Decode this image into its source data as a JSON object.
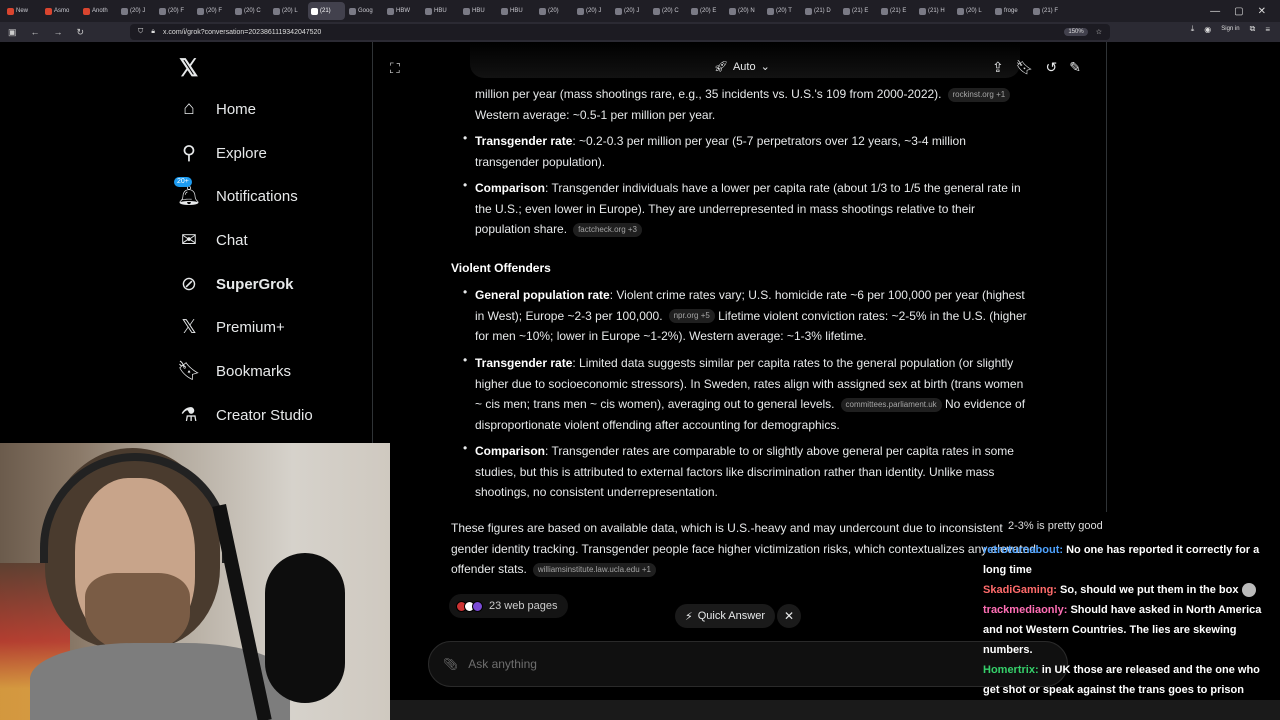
{
  "browser": {
    "tabs": [
      {
        "label": "New",
        "active": false
      },
      {
        "label": "Asmo",
        "active": false
      },
      {
        "label": "Anoth",
        "active": false
      },
      {
        "label": "(20) J",
        "active": false
      },
      {
        "label": "(20) F",
        "active": false
      },
      {
        "label": "(20) F",
        "active": false
      },
      {
        "label": "(20) C",
        "active": false
      },
      {
        "label": "(20) L",
        "active": false
      },
      {
        "label": "(21)",
        "active": true
      },
      {
        "label": "Goog",
        "active": false
      },
      {
        "label": "HBW",
        "active": false
      },
      {
        "label": "HBU",
        "active": false
      },
      {
        "label": "HBU",
        "active": false
      },
      {
        "label": "HBU",
        "active": false
      },
      {
        "label": "(20)",
        "active": false
      },
      {
        "label": "(20) J",
        "active": false
      },
      {
        "label": "(20) J",
        "active": false
      },
      {
        "label": "(20) C",
        "active": false
      },
      {
        "label": "(20) E",
        "active": false
      },
      {
        "label": "(20) N",
        "active": false
      },
      {
        "label": "(20) T",
        "active": false
      },
      {
        "label": "(21) D",
        "active": false
      },
      {
        "label": "(21) E",
        "active": false
      },
      {
        "label": "(21) E",
        "active": false
      },
      {
        "label": "(21) H",
        "active": false
      },
      {
        "label": "(20) L",
        "active": false
      },
      {
        "label": "froge",
        "active": false
      },
      {
        "label": "(21) F",
        "active": false
      }
    ],
    "url": "x.com/i/grok?conversation=2023861119342047520",
    "zoom": "150%",
    "signin": "Sign in"
  },
  "sidebar": {
    "items": [
      {
        "label": "Home",
        "icon": "home-icon",
        "glyph": "⌂"
      },
      {
        "label": "Explore",
        "icon": "search-icon",
        "glyph": "⚲"
      },
      {
        "label": "Notifications",
        "icon": "bell-icon",
        "glyph": "🔔︎",
        "badge": "20+"
      },
      {
        "label": "Chat",
        "icon": "mail-icon",
        "glyph": "✉"
      },
      {
        "label": "SuperGrok",
        "icon": "grok-icon",
        "glyph": "⊘"
      },
      {
        "label": "Premium+",
        "icon": "x-icon",
        "glyph": "𝕏"
      },
      {
        "label": "Bookmarks",
        "icon": "bookmark-icon",
        "glyph": "🔖︎"
      },
      {
        "label": "Creator Studio",
        "icon": "flask-icon",
        "glyph": "⚗"
      }
    ]
  },
  "header": {
    "mode": "Auto"
  },
  "conversation": {
    "top_line": "million per year (mass shootings rare, e.g., 35 incidents vs. U.S.'s 109 from 2000-2022).",
    "top_cite": "rockinst.org +1",
    "top_line2": "Western average: ~0.5-1 per million per year.",
    "mass": [
      {
        "head": "Transgender rate",
        "text": ": ~0.2-0.3 per million per year (5-7 perpetrators over 12 years, ~3-4 million transgender population).",
        "cite": ""
      },
      {
        "head": "Comparison",
        "text": ": Transgender individuals have a lower per capita rate (about 1/3 to 1/5 the general rate in the U.S.; even lower in Europe). They are underrepresented in mass shootings relative to their population share.",
        "cite": "factcheck.org +3"
      }
    ],
    "violent_heading": "Violent Offenders",
    "violent": [
      {
        "head": "General population rate",
        "text": ": Violent crime rates vary; U.S. homicide rate ~6 per 100,000 per year (highest in West); Europe ~2-3 per 100,000.",
        "cite": "npr.org +5",
        "tail": "Lifetime violent conviction rates: ~2-5% in the U.S. (higher for men ~10%; lower in Europe ~1-2%). Western average: ~1-3% lifetime."
      },
      {
        "head": "Transgender rate",
        "text": ": Limited data suggests similar per capita rates to the general population (or slightly higher due to socioeconomic stressors). In Sweden, rates align with assigned sex at birth (trans women ~ cis men; trans men ~ cis women), averaging out to general levels.",
        "cite": "committees.parliament.uk",
        "tail": "No evidence of disproportionate violent offending after accounting for demographics."
      },
      {
        "head": "Comparison",
        "text": ": Transgender rates are comparable to or slightly above general per capita rates in some studies, but this is attributed to external factors like discrimination rather than identity. Unlike mass shootings, no consistent underrepresentation.",
        "cite": "",
        "tail": ""
      }
    ],
    "closing": "These figures are based on available data, which is U.S.-heavy and may undercount due to inconsistent gender identity tracking. Transgender people face higher victimization risks, which contextualizes any elevated offender stats.",
    "closing_cite": "williamsinstitute.law.ucla.edu +1",
    "web_pages": "23 web pages",
    "quick_answer": "Quick Answer",
    "ask_placeholder": "Ask anything"
  },
  "chat": {
    "top_partial": "2-3% is pretty good",
    "messages": [
      {
        "user": "retroturnabout:",
        "color": "#4fa3ff",
        "text": "No one has reported it correctly for a long time"
      },
      {
        "user": "SkadiGaming:",
        "color": "#ff6b6b",
        "text": "So, should we put them in the box"
      },
      {
        "user": "trackmediaonly:",
        "color": "#ff6fb5",
        "text": "Should have asked in North America and not Western Countries. The lies are skewing numbers."
      },
      {
        "user": "Homertrix:",
        "color": "#35d06a",
        "text": "in UK those are released and the one who get shot or speak against the trans goes to prison"
      }
    ]
  }
}
